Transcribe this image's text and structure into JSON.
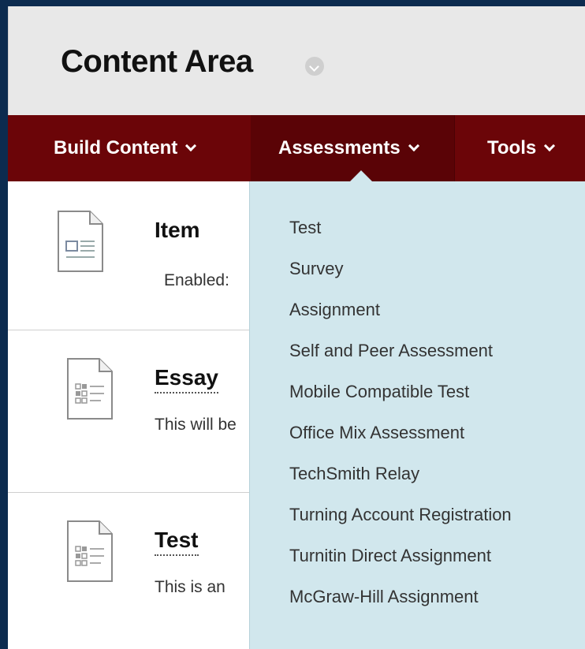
{
  "header": {
    "title": "Content Area"
  },
  "action_bar": {
    "build_content": "Build Content",
    "assessments": "Assessments",
    "tools": "Tools"
  },
  "items": [
    {
      "title": "Item",
      "text": "Enabled:",
      "icon": "document-icon"
    },
    {
      "title": "Essay",
      "text": "This will be",
      "icon": "assessment-document-icon"
    },
    {
      "title": "Test",
      "text": "This is an",
      "icon": "assessment-document-icon"
    }
  ],
  "assessments_menu": [
    "Test",
    "Survey",
    "Assignment",
    "Self and Peer Assessment",
    "Mobile Compatible Test",
    "Office Mix Assessment",
    "TechSmith Relay",
    "Turning Account Registration",
    "Turnitin Direct Assignment",
    "McGraw-Hill Assignment"
  ],
  "colors": {
    "frame": "#0c2b4f",
    "action_bar": "#6b0508",
    "dropdown": "#d1e7ed",
    "header": "#e8e8e8"
  }
}
